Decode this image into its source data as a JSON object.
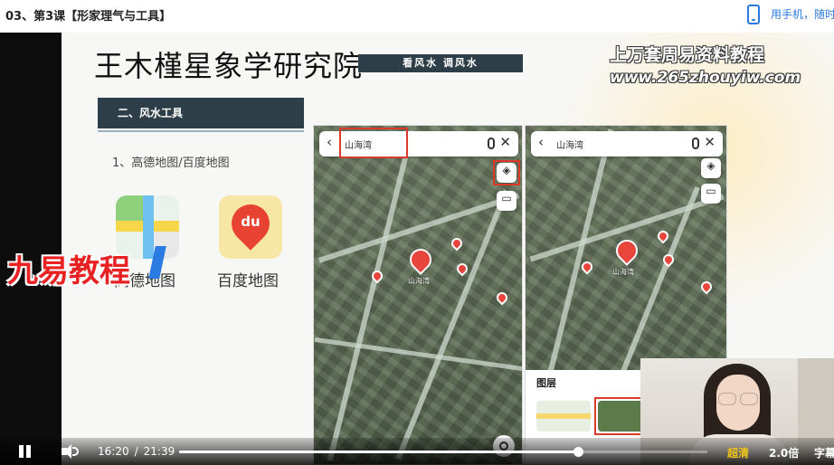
{
  "header": {
    "course_title": "03、第3课【形家理气与工具】",
    "phone_link": "用手机，随时"
  },
  "slide": {
    "institute_title": "王木槿星象学研究院",
    "motto": "看风水 调风水",
    "section_title": "二、风水工具",
    "sub_item": "1、高德地图/百度地图",
    "apps": [
      {
        "label": "高德地图",
        "icon": "amap-icon"
      },
      {
        "label": "百度地图",
        "icon": "baidu-map-icon",
        "icon_text": "du"
      }
    ]
  },
  "watermarks": {
    "top_line": "上万套周易资料教程",
    "url": "www.265zhouyiw.com",
    "channel": "九易教程"
  },
  "maps": {
    "search_query": "山海湾",
    "poi_label": "山海湾",
    "layer_panel_title": "图层",
    "highlight_color": "#d93a2a",
    "poi_color": "#e8453c"
  },
  "player": {
    "current_time": "16:20",
    "separator": "/",
    "duration": "21:39",
    "progress": 0.7545,
    "quality": "超清",
    "speed": "2.0倍",
    "subtitle": "字幕"
  },
  "colors": {
    "accent_blue": "#2a7ae2",
    "slide_bar": "#2e3e48",
    "quality_gold": "#f0c419"
  }
}
